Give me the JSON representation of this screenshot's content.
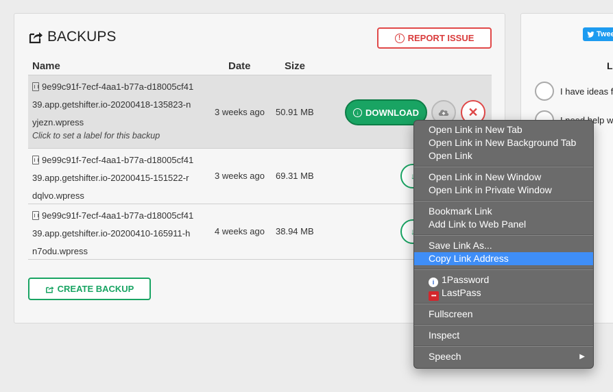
{
  "backups": {
    "title": "BACKUPS",
    "report_label": "REPORT ISSUE",
    "columns": {
      "name": "Name",
      "date": "Date",
      "size": "Size"
    },
    "rows": [
      {
        "name_lines": [
          "9e99c91f-7ecf-4aa1-b77a-d18005cf41",
          "39.app.getshifter.io-20200418-135823-n",
          "yjezn.wpress"
        ],
        "label_hint": "Click to set a label for this backup",
        "date": "3 weeks ago",
        "size": "50.91 MB",
        "download_label": "DOWNLOAD"
      },
      {
        "name_lines": [
          "9e99c91f-7ecf-4aa1-b77a-d18005cf41",
          "39.app.getshifter.io-20200415-151522-r",
          "dqlvo.wpress"
        ],
        "date": "3 weeks ago",
        "size": "69.31 MB"
      },
      {
        "name_lines": [
          "9e99c91f-7ecf-4aa1-b77a-d18005cf41",
          "39.app.getshifter.io-20200410-165911-h",
          "n7odu.wpress"
        ],
        "date": "4 weeks ago",
        "size": "38.94 MB"
      }
    ],
    "create_label": "CREATE BACKUP"
  },
  "side": {
    "tweet_label": "Twee",
    "heading": "L",
    "options": [
      "I have ideas f",
      "I need help w"
    ]
  },
  "context_menu": {
    "groups": [
      [
        "Open Link in New Tab",
        "Open Link in New Background Tab",
        "Open Link"
      ],
      [
        "Open Link in New Window",
        "Open Link in Private Window"
      ],
      [
        "Bookmark Link",
        "Add Link to Web Panel"
      ],
      [
        "Save Link As...",
        "Copy Link Address"
      ],
      [
        "1Password",
        "LastPass"
      ],
      [
        "Fullscreen"
      ],
      [
        "Inspect"
      ],
      [
        "Speech"
      ]
    ],
    "highlighted": "Copy Link Address"
  },
  "colors": {
    "green": "#19a463",
    "red": "#e04848",
    "highlight": "#3f8ef7"
  }
}
